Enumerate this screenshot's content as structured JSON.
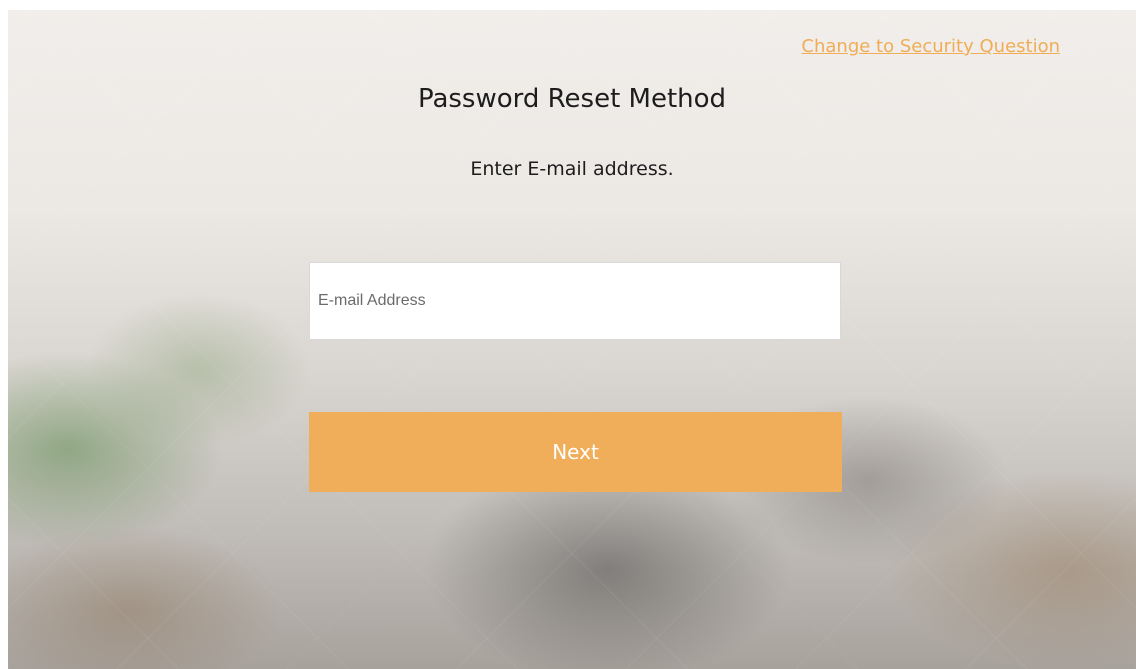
{
  "header": {
    "change_link": "Change to Security Question"
  },
  "main": {
    "title": "Password Reset Method",
    "subtitle": "Enter E-mail address.",
    "email_input": {
      "placeholder": "E-mail Address",
      "value": ""
    },
    "next_button": "Next"
  },
  "colors": {
    "accent": "#f0ae5a",
    "link": "#f0ad55"
  }
}
